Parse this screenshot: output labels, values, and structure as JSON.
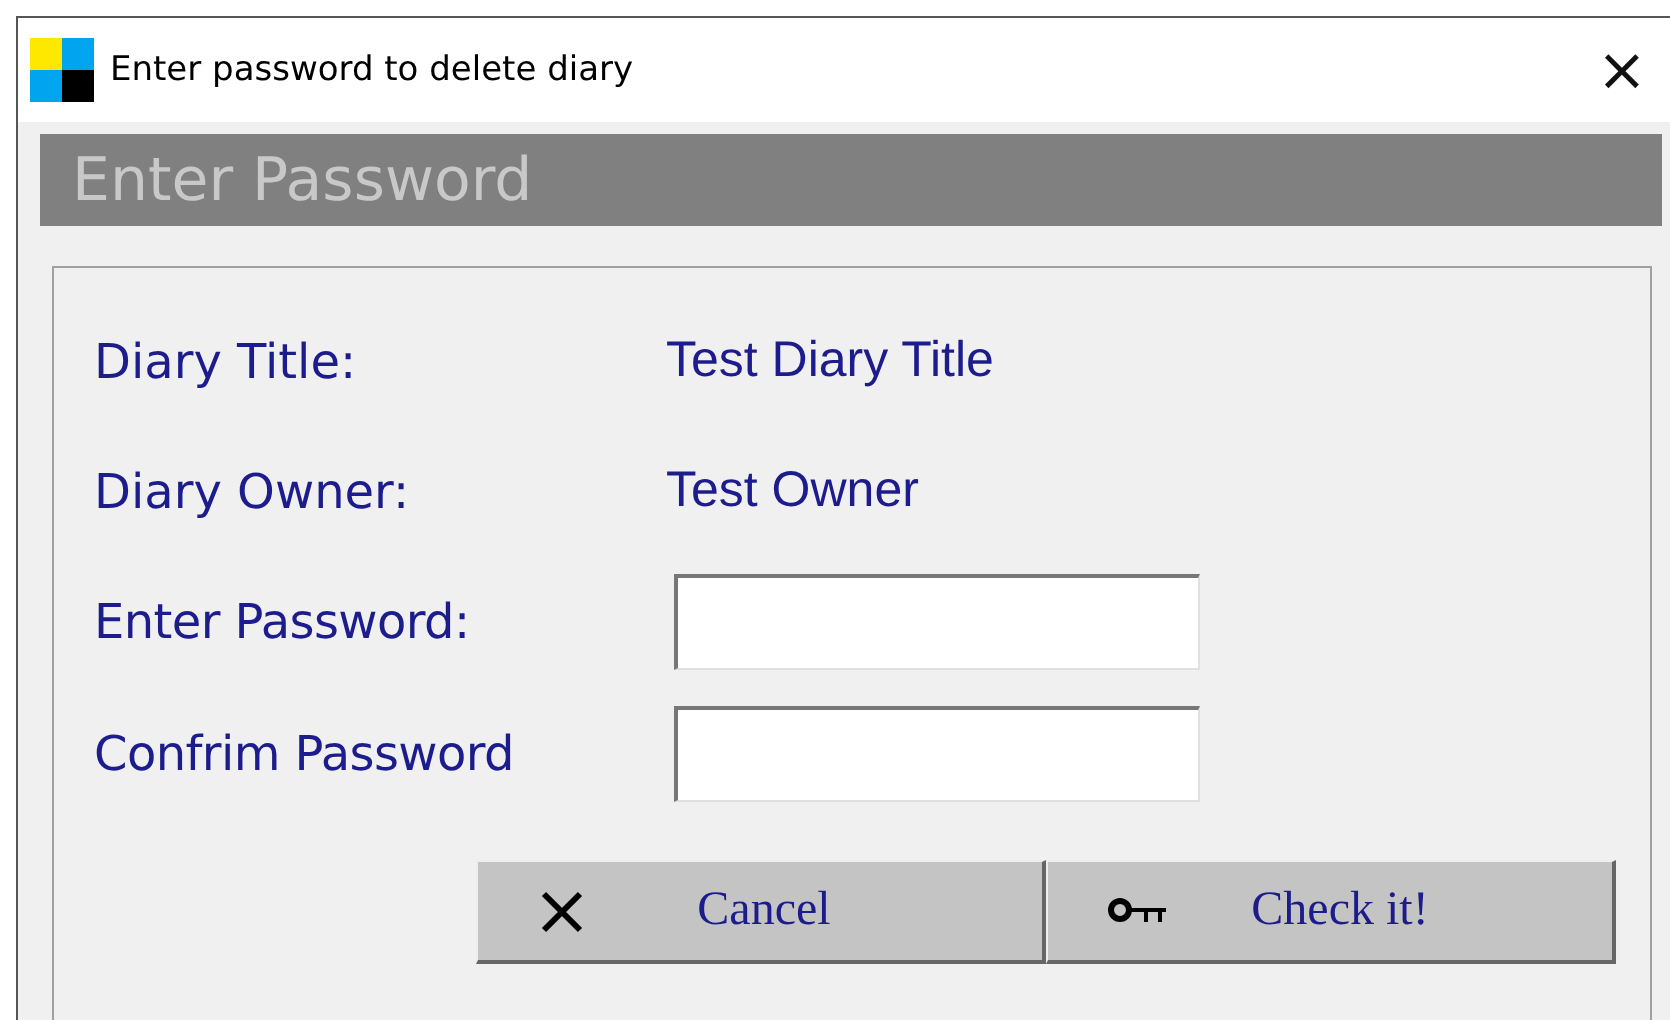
{
  "window": {
    "title": "Enter password to delete diary",
    "close": "×"
  },
  "header": "Enter Password",
  "info": [
    {
      "label": "Diary Title:",
      "value": "Test Diary Title"
    },
    {
      "label": "Diary Owner:",
      "value": "Test Owner"
    }
  ],
  "fields": [
    {
      "label": "Enter Password:"
    },
    {
      "label": "Confrim Password"
    }
  ],
  "buttons": [
    {
      "kind": "cancel",
      "label": "Cancel"
    },
    {
      "kind": "check",
      "label": "Check it!"
    }
  ]
}
